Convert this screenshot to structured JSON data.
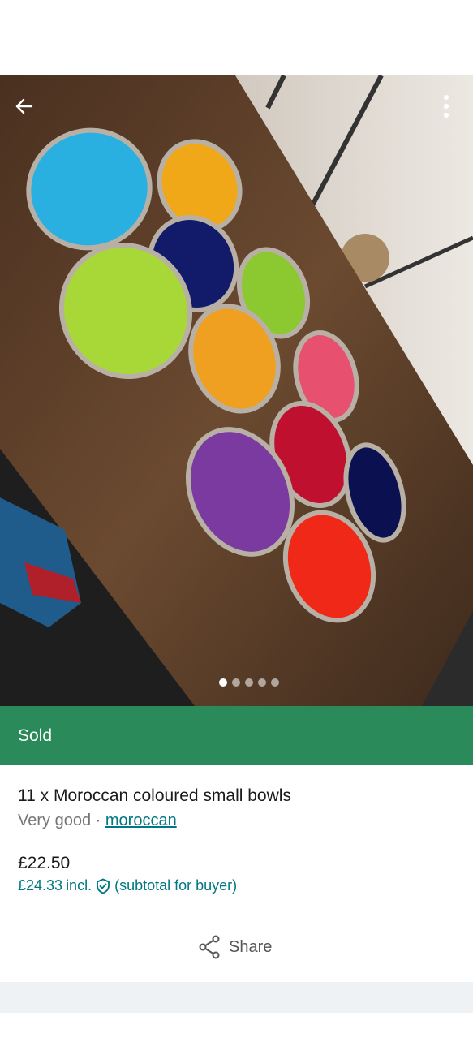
{
  "photo": {
    "product_image_alt": "11 x Moroccan coloured small bowls",
    "carousel": {
      "total": 5,
      "active_index": 0
    }
  },
  "status": {
    "label": "Sold",
    "color": "#2a8a5a"
  },
  "item": {
    "title": "11 x Moroccan coloured small bowls",
    "condition": "Very good",
    "separator": "·",
    "brand": "moroccan",
    "price": "£22.50",
    "buyer_price": "£24.33",
    "buyer_price_incl": "incl.",
    "buyer_price_note": "(subtotal for buyer)"
  },
  "actions": {
    "share_label": "Share"
  },
  "icons": {
    "back": "arrow-left-icon",
    "more": "more-vertical-icon",
    "protection": "shield-check-icon",
    "share": "share-icon"
  },
  "colors": {
    "accent": "#007782",
    "sold": "#2a8a5a"
  }
}
